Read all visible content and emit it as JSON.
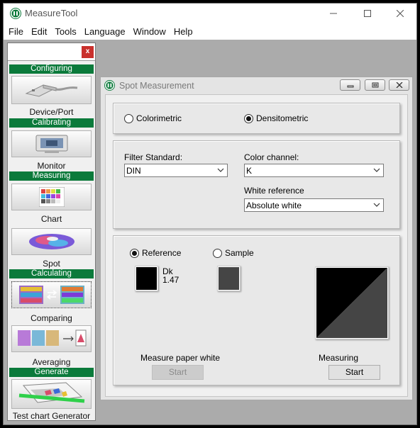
{
  "window": {
    "title": "MeasureTool"
  },
  "menu": [
    "File",
    "Edit",
    "Tools",
    "Language",
    "Window",
    "Help"
  ],
  "toolbox": {
    "close_label": "x",
    "sections": {
      "configuring": "Configuring",
      "calibrating": "Calibrating",
      "measuring": "Measuring",
      "calculating": "Calculating",
      "generate": "Generate"
    },
    "items": {
      "device_port": "Device/Port",
      "monitor": "Monitor",
      "chart": "Chart",
      "spot": "Spot",
      "comparing": "Comparing",
      "averaging": "Averaging",
      "test_chart_generator": "Test chart Generator"
    }
  },
  "spot_window": {
    "title": "Spot Measurement",
    "mode": {
      "colorimetric": "Colorimetric",
      "densitometric": "Densitometric",
      "selected": "densitometric"
    },
    "filter_standard": {
      "label": "Filter Standard:",
      "value": "DIN"
    },
    "color_channel": {
      "label": "Color channel:",
      "value": "K"
    },
    "white_reference": {
      "label": "White reference",
      "value": "Absolute white"
    },
    "measurement": {
      "reference_label": "Reference",
      "sample_label": "Sample",
      "selected": "reference",
      "reference_name": "Dk",
      "reference_value": "1.47",
      "reference_color": "#000000",
      "sample_color": "#454545",
      "measure_paper_white_label": "Measure paper white",
      "paper_white_start": "Start",
      "measuring_label": "Measuring",
      "measuring_start": "Start"
    }
  },
  "colors": {
    "accent_green": "#0b7a3b",
    "close_red": "#c9302c",
    "workspace": "#ababab"
  }
}
